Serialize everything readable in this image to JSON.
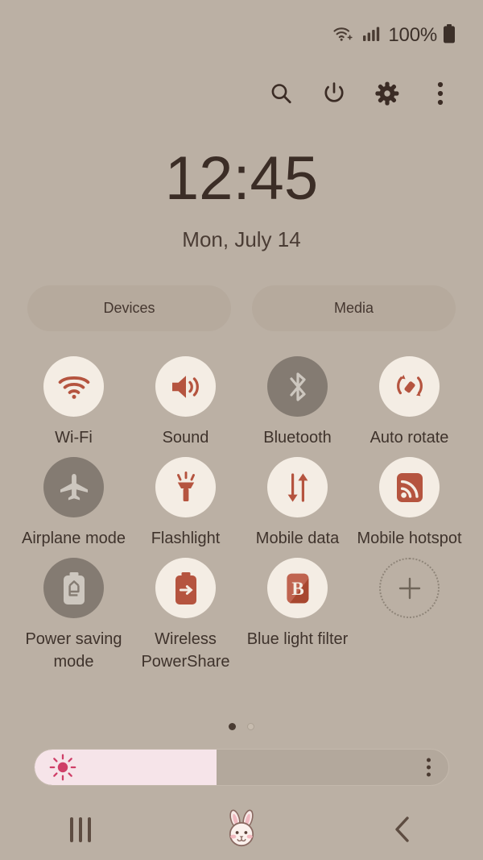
{
  "status_bar": {
    "wifi_icon": "wifi-plus-icon",
    "signal_icon": "cellular-signal-icon",
    "battery_percent": "100%",
    "battery_icon": "battery-full-icon"
  },
  "action_bar": {
    "items": [
      {
        "name": "search-icon",
        "label": "Search"
      },
      {
        "name": "power-icon",
        "label": "Power"
      },
      {
        "name": "settings-gear-icon",
        "label": "Settings"
      },
      {
        "name": "overflow-menu-icon",
        "label": "More options"
      }
    ]
  },
  "clock": {
    "time": "12:45",
    "date": "Mon, July 14"
  },
  "pills": [
    {
      "label": "Devices",
      "name": "devices-button"
    },
    {
      "label": "Media",
      "name": "media-button"
    }
  ],
  "toggles": [
    {
      "label": "Wi-Fi",
      "icon": "wifi-icon",
      "state": "on"
    },
    {
      "label": "Sound",
      "icon": "sound-speaker-icon",
      "state": "on"
    },
    {
      "label": "Bluetooth",
      "icon": "bluetooth-icon",
      "state": "off"
    },
    {
      "label": "Auto rotate",
      "icon": "auto-rotate-icon",
      "state": "on"
    },
    {
      "label": "Airplane mode",
      "icon": "airplane-icon",
      "state": "off"
    },
    {
      "label": "Flashlight",
      "icon": "flashlight-icon",
      "state": "on"
    },
    {
      "label": "Mobile data",
      "icon": "mobile-data-icon",
      "state": "on"
    },
    {
      "label": "Mobile hotspot",
      "icon": "mobile-hotspot-icon",
      "state": "on"
    },
    {
      "label": "Power saving mode",
      "icon": "power-saving-battery-icon",
      "state": "off"
    },
    {
      "label": "Wireless PowerShare",
      "icon": "wireless-powershare-icon",
      "state": "on"
    },
    {
      "label": "Blue light filter",
      "icon": "blue-light-filter-icon",
      "state": "on"
    },
    {
      "label": "",
      "icon": "add-plus-icon",
      "state": "add"
    }
  ],
  "page_indicator": {
    "total": 2,
    "current": 1
  },
  "brightness": {
    "level_percent": 44,
    "sun_icon": "brightness-sun-icon",
    "menu_icon": "brightness-options-icon"
  },
  "nav_bar": {
    "recents": "recents-icon",
    "home": "home-bunny-icon",
    "back": "back-chevron-icon"
  },
  "colors": {
    "background": "#bbb0a4",
    "accent_red": "#b5543f",
    "tile_on_bg": "#f4ede4",
    "tile_off_bg": "#847b72",
    "text_dark": "#3b2f2a",
    "brightness_fill": "#f6e4e9",
    "brightness_sun": "#cf3f68"
  }
}
